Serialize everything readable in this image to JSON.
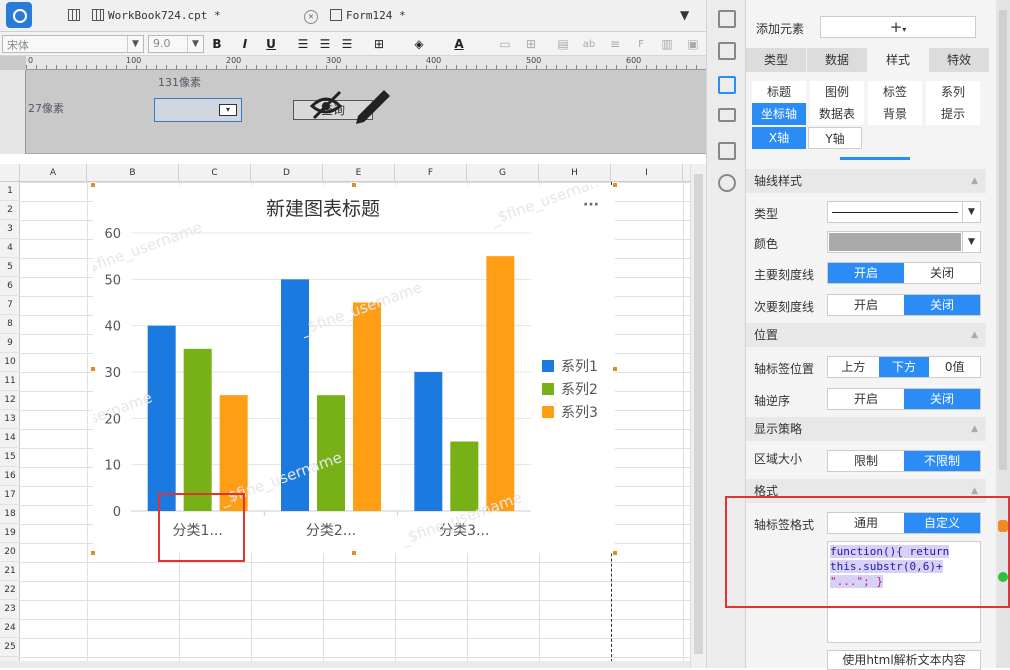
{
  "tabs": [
    {
      "label": "WorkBook724.cpt *"
    },
    {
      "label": "Form124 *"
    }
  ],
  "toolbar": {
    "font_name": "宋体",
    "font_size": "9.0",
    "bold": "B",
    "italic": "I",
    "underline": "U"
  },
  "form": {
    "width_label": "131像素",
    "height_label": "27像素",
    "query_button": "查询"
  },
  "sheet": {
    "columns": [
      "A",
      "B",
      "C",
      "D",
      "E",
      "F",
      "G",
      "H",
      "I"
    ],
    "rows": [
      "1",
      "2",
      "3",
      "4",
      "5",
      "6",
      "7",
      "8",
      "9",
      "10",
      "11",
      "12",
      "13",
      "14",
      "15",
      "16",
      "17",
      "18",
      "19",
      "20",
      "21",
      "22",
      "23",
      "24",
      "25"
    ]
  },
  "watermark": "_$fine_username",
  "chart_data": {
    "type": "bar",
    "title": "新建图表标题",
    "categories": [
      "分类1...",
      "分类2...",
      "分类3..."
    ],
    "series": [
      {
        "name": "系列1",
        "values": [
          40,
          50,
          30
        ],
        "color": "#1a7ae0"
      },
      {
        "name": "系列2",
        "values": [
          35,
          25,
          15
        ],
        "color": "#77b017"
      },
      {
        "name": "系列3",
        "values": [
          25,
          45,
          55
        ],
        "color": "#ff9d14"
      }
    ],
    "yticks": [
      "0",
      "10",
      "20",
      "30",
      "40",
      "50",
      "60"
    ],
    "ylim": [
      0,
      60
    ],
    "legend": "right",
    "grid": true
  },
  "panel": {
    "add_element_label": "添加元素",
    "add_button": "+",
    "top_tabs": [
      "类型",
      "数据",
      "样式",
      "特效"
    ],
    "sub_tabs_row1": [
      "标题",
      "图例",
      "标签",
      "系列"
    ],
    "sub_tabs_row2": [
      "坐标轴",
      "数据表",
      "背景",
      "提示"
    ],
    "axis_tabs": [
      "X轴",
      "Y轴"
    ],
    "section_axis_style": "轴线样式",
    "type_label": "类型",
    "color_label": "颜色",
    "major_tick_label": "主要刻度线",
    "minor_tick_label": "次要刻度线",
    "on_label": "开启",
    "off_label": "关闭",
    "section_position": "位置",
    "label_position_label": "轴标签位置",
    "label_positions": [
      "上方",
      "下方",
      "0值"
    ],
    "reverse_label": "轴逆序",
    "section_strategy": "显示策略",
    "region_size_label": "区域大小",
    "region_options": [
      "限制",
      "不限制"
    ],
    "section_format": "格式",
    "label_format_label": "轴标签格式",
    "format_options": [
      "通用",
      "自定义"
    ],
    "format_code": [
      "function(){ return",
      "this.substr(0,6)+",
      "\"...\"; }"
    ],
    "html_button": "使用html解析文本内容"
  }
}
